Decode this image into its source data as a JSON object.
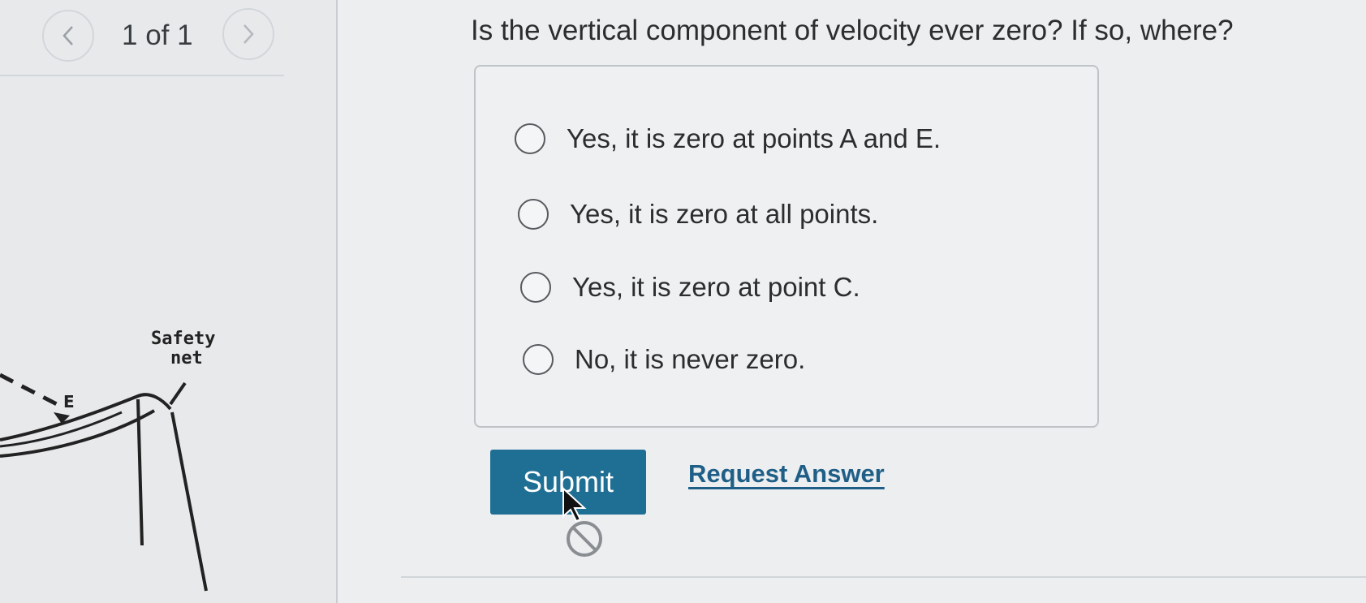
{
  "pager": {
    "text": "1 of 1"
  },
  "figure": {
    "label_net": [
      "Safety",
      "net"
    ],
    "label_point": "E"
  },
  "question": {
    "text": "Is the vertical component of velocity ever zero? If so, where?"
  },
  "options": [
    {
      "label": "Yes, it is zero at points A and E.",
      "selected": false
    },
    {
      "label": "Yes, it is zero at all points.",
      "selected": false
    },
    {
      "label": "Yes, it is zero at point C.",
      "selected": false
    },
    {
      "label": "No, it is never zero.",
      "selected": false
    }
  ],
  "actions": {
    "submit_label": "Submit",
    "request_answer_label": "Request Answer"
  },
  "colors": {
    "submit_bg": "#1f6f95",
    "link": "#1f5f87"
  }
}
